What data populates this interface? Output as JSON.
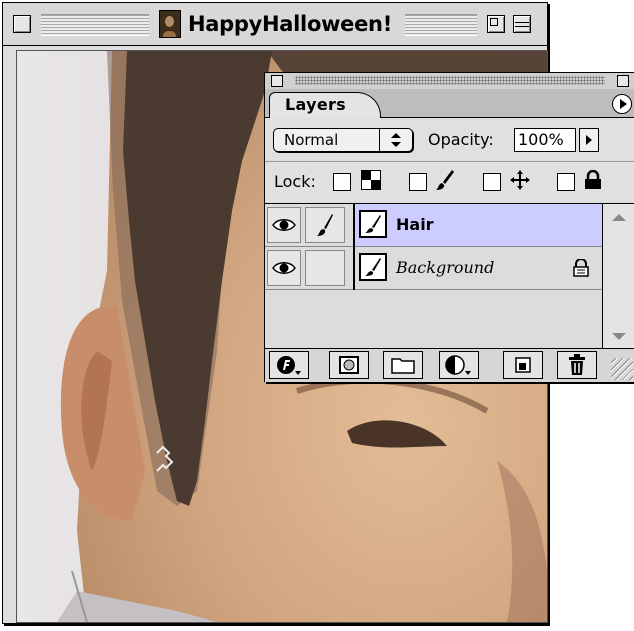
{
  "document_window": {
    "title": "HappyHalloween!"
  },
  "layers_palette": {
    "tab_label": "Layers",
    "blend_mode": "Normal",
    "opacity_label": "Opacity:",
    "opacity_value": "100%",
    "lock_label": "Lock:",
    "layers": [
      {
        "name": "Hair",
        "selected": true,
        "visible": true
      },
      {
        "name": "Background",
        "selected": false,
        "visible": true,
        "locked": true
      }
    ],
    "footer_buttons": [
      "layer-effects-icon",
      "add-mask-icon",
      "new-set-icon",
      "new-fill-adjustment-icon",
      "new-layer-icon",
      "trash-icon"
    ],
    "colors": {
      "selected_row": "#ccccff",
      "palette_bg": "#dcdcdc"
    }
  }
}
